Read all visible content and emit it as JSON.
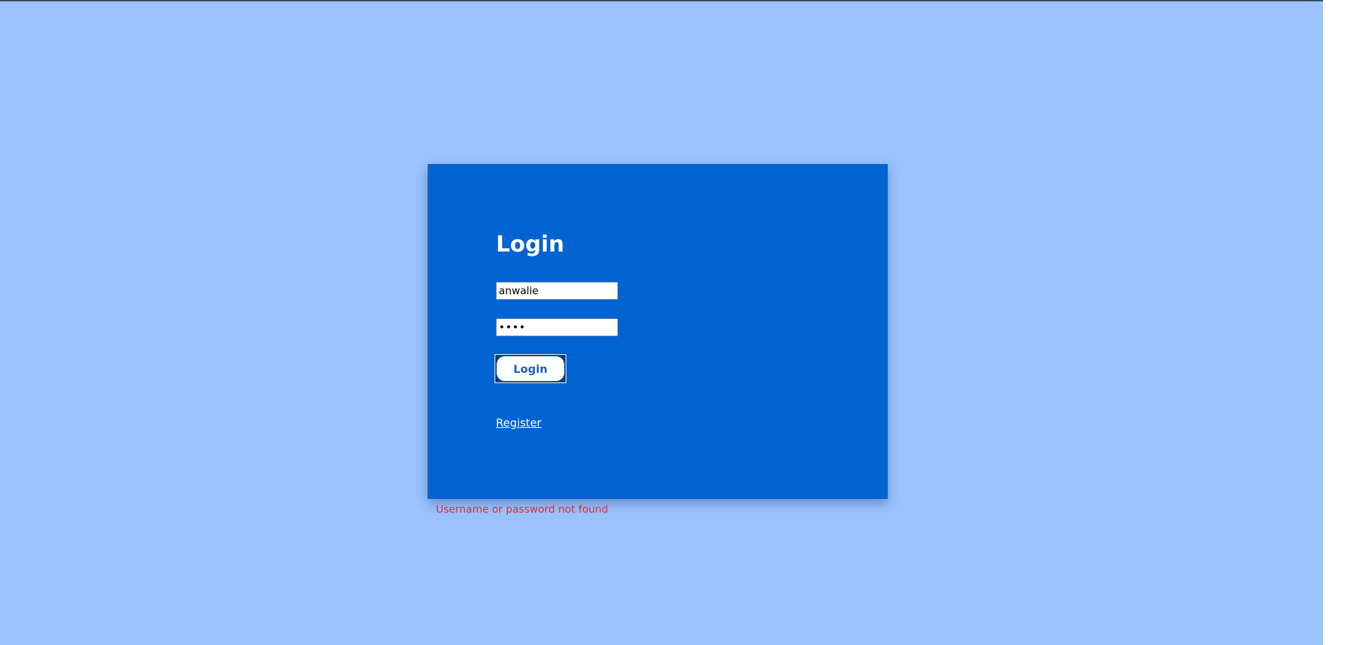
{
  "login_form": {
    "title": "Login",
    "username_value": "anwalie",
    "password_value": "••••",
    "login_button_label": "Login",
    "register_link_label": "Register"
  },
  "messages": {
    "error": "Username or password not found"
  },
  "colors": {
    "page_background": "#9ac2fd",
    "card_background": "#0063d1",
    "error_text": "#e8283a",
    "button_text": "#1a5fb4"
  }
}
